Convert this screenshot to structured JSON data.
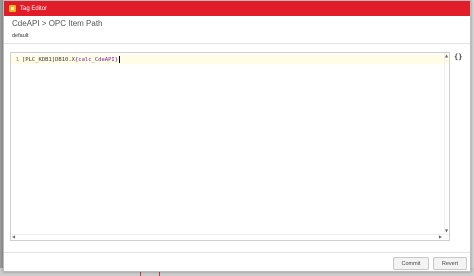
{
  "window": {
    "title": "Tag Editor"
  },
  "header": {
    "path_title": "CdeAPI > OPC Item Path",
    "provider": "default"
  },
  "editor": {
    "line_number": "1",
    "code_static": "[PLC_KDB1]DB10.X",
    "code_param": "{calc_CdeAPI}",
    "expression_button": "{}"
  },
  "footer": {
    "commit_label": "Commit",
    "revert_label": "Revert"
  },
  "colors": {
    "titlebar": "#e11d2a",
    "current_line": "#fffde6",
    "param_text": "#7a1f9e"
  },
  "icons": {
    "window": "app-icon",
    "expression": "braces-icon"
  }
}
